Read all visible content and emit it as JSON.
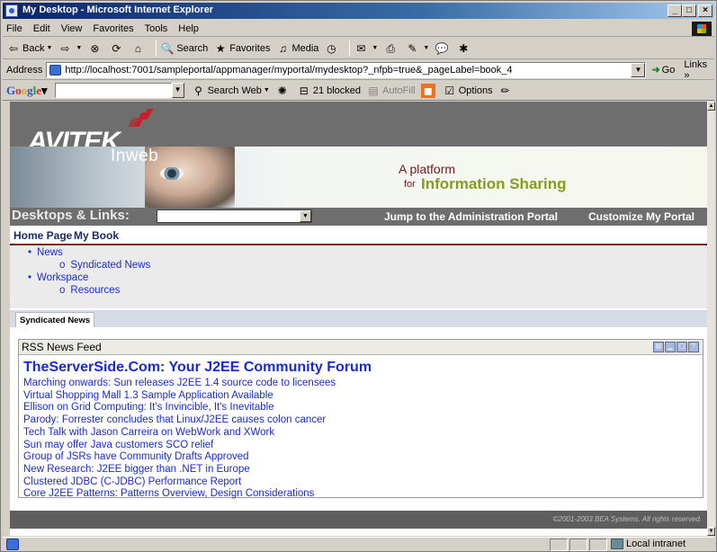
{
  "window": {
    "title": "My Desktop - Microsoft Internet Explorer",
    "min_label": "_",
    "max_label": "□",
    "close_label": "×"
  },
  "menu": [
    "File",
    "Edit",
    "View",
    "Favorites",
    "Tools",
    "Help"
  ],
  "toolbar": {
    "back": "Back",
    "search": "Search",
    "favorites": "Favorites",
    "media": "Media"
  },
  "address": {
    "label": "Address",
    "url": "http://localhost:7001/sampleportal/appmanager/myportal/mydesktop?_nfpb=true&_pageLabel=book_4",
    "go": "Go",
    "links": "Links »"
  },
  "googlebar": {
    "search_web": "Search Web",
    "blocked": "21 blocked",
    "autofill": "AutoFill",
    "options": "Options"
  },
  "portal": {
    "brand": "AVITEK",
    "sub_brand": "Inweb",
    "tagline1": "A platform",
    "tagline2_prefix": "for",
    "tagline2": "Information Sharing",
    "desktops_label": "Desktops & Links:",
    "jump_link": "Jump to the Administration Portal",
    "customize_link": "Customize My Portal",
    "page_tabs": [
      "Home Page",
      "My Book"
    ],
    "tree": {
      "news": "News",
      "syndicated": "Syndicated News",
      "workspace": "Workspace",
      "resources": "Resources"
    },
    "active_tab": "Syndicated News",
    "portlet_title": "RSS News Feed",
    "feed_title": "TheServerSide.Com: Your J2EE Community Forum",
    "feed_items": [
      "Marching onwards: Sun releases J2EE 1.4 source code to licensees",
      "Virtual Shopping Mall 1.3 Sample Application Available",
      "Ellison on Grid Computing: It's Invincible, It's Inevitable",
      "Parody: Forrester concludes that Linux/J2EE causes colon cancer",
      "Tech Talk with Jason Carreira on WebWork and XWork",
      "Sun may offer Java customers SCO relief",
      "Group of JSRs have Community Drafts Approved",
      "New Research: J2EE bigger than .NET in Europe",
      "Clustered JDBC (C-JDBC) Performance Report",
      "Core J2EE Patterns: Patterns Overview, Design Considerations"
    ],
    "footer": "©2001-2003 BEA Systems. All rights reserved."
  },
  "status": {
    "zone": "Local intranet"
  }
}
